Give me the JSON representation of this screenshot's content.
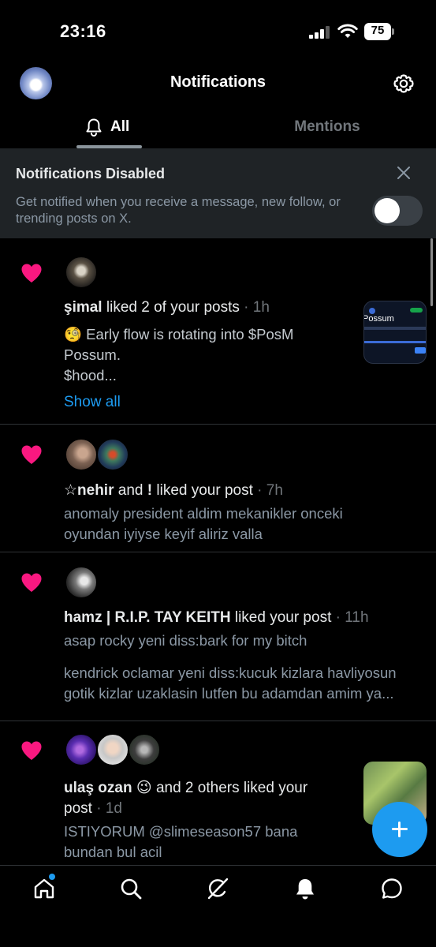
{
  "status_bar": {
    "time": "23:16",
    "battery": "75"
  },
  "header": {
    "title": "Notifications"
  },
  "tabs": [
    {
      "label": "All",
      "active": true
    },
    {
      "label": "Mentions",
      "active": false
    }
  ],
  "banner": {
    "title": "Notifications Disabled",
    "text": "Get notified when you receive a message, new follow, or trending posts on X.",
    "toggle_on": false
  },
  "notifications": [
    {
      "user": "şimal",
      "action": " liked 2 of your posts",
      "time": "1h",
      "body": "🧐 Early flow is rotating into $PosM Possum.\n$hood...",
      "body_line1": "🧐 Early flow is rotating into $PosM",
      "body_line2": "Possum.",
      "body_line3": "$hood...",
      "show_all": "Show all",
      "thumb_title": "Possum"
    },
    {
      "user1": "☆nehir",
      "and": " and ",
      "user2": "!",
      "action": " liked your post",
      "time": "7h",
      "body_line1": "anomaly president aldim mekanikler onceki",
      "body_line2": "oyundan iyiyse keyif aliriz valla"
    },
    {
      "user": "hamz | R.I.P. TAY KEITH",
      "action": " liked your post",
      "time": "11h",
      "body_line1": "asap rocky yeni diss:bark for my bitch",
      "body_line2": "kendrick oclamar yeni diss:kucuk kizlara havliyosun",
      "body_line3": "gotik kizlar uzaklasin lutfen bu adamdan amim ya..."
    },
    {
      "user": "ulaş ozan",
      "emoji": "😉",
      "action_line1": " and 2 others liked your",
      "action_line2": "post",
      "time": "1d",
      "body_line1": "ISTIYORUM @slimeseason57 bana",
      "body_line2": "bundan bul acil"
    }
  ],
  "bottom_nav": [
    "home-icon",
    "search-icon",
    "grok-icon",
    "notifications-icon",
    "messages-icon"
  ],
  "colors": {
    "accent": "#1d9bf0",
    "heart": "#f91880",
    "banner_bg": "#1f2326",
    "muted": "#71767b"
  }
}
